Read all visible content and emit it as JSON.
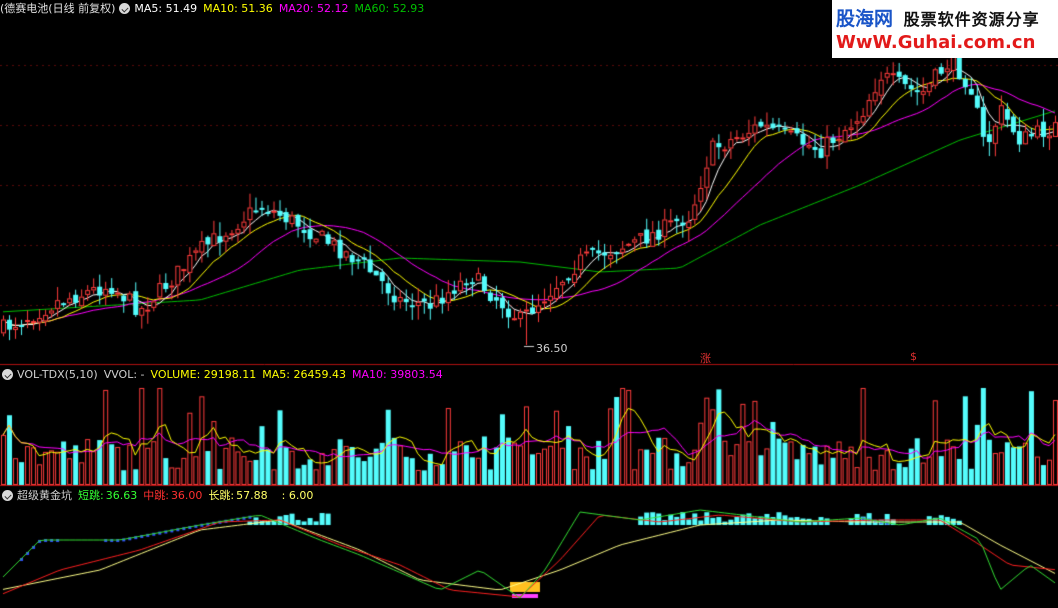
{
  "price_panel": {
    "title": "(德赛电池(日线 前复权)",
    "ma5": "MA5: 51.49",
    "ma10": "MA10: 51.36",
    "ma20": "MA20: 52.12",
    "ma60": "MA60: 52.93",
    "low_label": "36.50",
    "mark_1": "涨",
    "mark_2": "$"
  },
  "volume_panel": {
    "title": "VOL-TDX(5,10)",
    "vvol": "VVOL: -",
    "volume": "VOLUME: 29198.11",
    "ma5": "MA5: 26459.43",
    "ma10": "MA10: 39803.54"
  },
  "indicator_panel": {
    "title": "超级黄金坑",
    "short_label": "短跳:",
    "short_value": "36.63",
    "mid_label": "中跳:",
    "mid_value": "36.00",
    "long_label": "长跳:",
    "long_value": "57.88",
    "extra_value": ": 6.00"
  },
  "watermark": {
    "brand": "股海网",
    "slogan": "股票软件资源分享",
    "url": "WwW.Guhai.com.cn"
  },
  "colors": {
    "up": "#ff3c3c",
    "down": "#54fcfc",
    "ma5": "#ffffff",
    "ma10": "#ffff00",
    "ma20": "#ff00ff",
    "ma60": "#00c000",
    "panel_border": "#b01010"
  }
}
